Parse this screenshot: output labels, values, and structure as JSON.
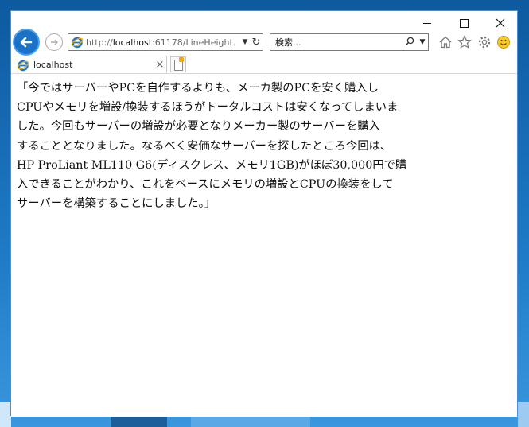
{
  "browser": {
    "address": {
      "prefix": "http://",
      "host": "localhost",
      "rest": ":61178/LineHeight."
    },
    "search": {
      "placeholder": "検索..."
    },
    "tab": {
      "title": "localhost"
    },
    "window_controls": {
      "minimize": "–",
      "maximize": "□",
      "close": "✕"
    }
  },
  "icons": {
    "back": "back-arrow-icon",
    "forward": "forward-arrow-icon",
    "ie": "ie-logo-icon",
    "refresh": "refresh-icon",
    "search": "search-icon",
    "home": "home-icon",
    "favorites": "star-icon",
    "settings": "gear-icon",
    "feedback": "smiley-icon",
    "new_tab": "new-tab-icon"
  },
  "content": {
    "lines": [
      "「今ではサーバーやPCを自作するよりも、メーカ製のPCを安く購入し",
      "CPUやメモリを増設/換装するほうがトータルコストは安くなってしまいま",
      "した。今回もサーバーの増設が必要となりメーカー製のサーバーを購入",
      "することとなりました。なるべく安価なサーバーを探したところ今回は、",
      "HP ProLiant ML110 G6(ディスクレス、メモリ1GB)がほぼ30,000円で購",
      "入できることがわかり、これをベースにメモリの増設とCPUの換装をして",
      "サーバーを構築することにしました。」"
    ]
  },
  "colors": {
    "accent": "#1a73c8",
    "desktop": "#1e7bc7",
    "window_border": "#4a90d9"
  }
}
